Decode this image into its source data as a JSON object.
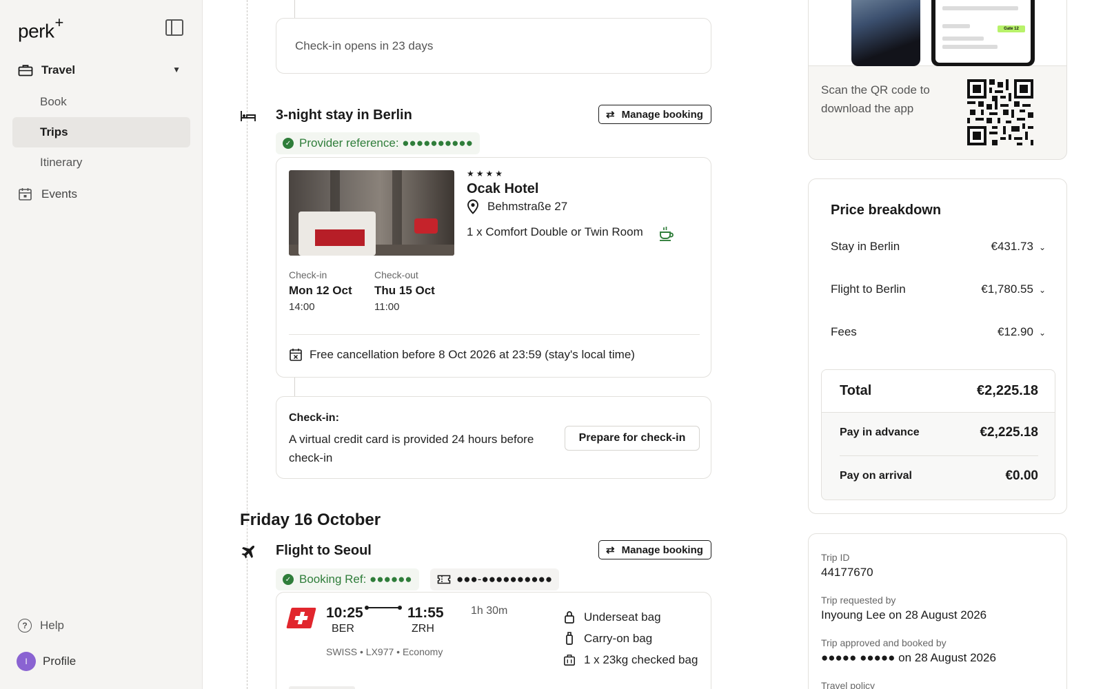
{
  "sidebar": {
    "logo": "perk",
    "logo_mark": "+",
    "travel_label": "Travel",
    "items": [
      {
        "label": "Book"
      },
      {
        "label": "Trips"
      },
      {
        "label": "Itinerary"
      }
    ],
    "events_label": "Events",
    "help_label": "Help",
    "profile_label": "Profile",
    "profile_initial": "I"
  },
  "checkin_notice": "Check-in opens in 23 days",
  "hotel_section": {
    "title": "3-night stay in Berlin",
    "manage_label": "Manage booking",
    "provider_reference": "Provider reference: ●●●●●●●●●●",
    "stars": "★★★★",
    "hotel_name": "Ocak Hotel",
    "address": "Behmstraße 27",
    "room": "1 x Comfort Double or Twin Room",
    "checkin_label": "Check-in",
    "checkin_date": "Mon 12 Oct",
    "checkin_time": "14:00",
    "checkout_label": "Check-out",
    "checkout_date": "Thu 15 Oct",
    "checkout_time": "11:00",
    "cancellation": "Free cancellation before 8 Oct 2026 at 23:59 (stay's local time)"
  },
  "prepare": {
    "title": "Check-in:",
    "text": "A virtual credit card is provided 24 hours before check-in",
    "button": "Prepare for check-in"
  },
  "day_heading": "Friday 16 October",
  "flight_section": {
    "title": "Flight to Seoul",
    "manage_label": "Manage booking",
    "booking_ref": "Booking Ref: ●●●●●●",
    "ticket_ref": "●●●-●●●●●●●●●●",
    "depart_time": "10:25",
    "depart_code": "BER",
    "arrive_time": "11:55",
    "arrive_code": "ZRH",
    "duration": "1h 30m",
    "carrier": "SWISS • LX977 • Economy",
    "bags": [
      {
        "label": "Underseat bag",
        "icon": "lock-bag-icon"
      },
      {
        "label": "Carry-on bag",
        "icon": "carry-on-icon"
      },
      {
        "label": "1 x 23kg checked bag",
        "icon": "suitcase-icon"
      }
    ]
  },
  "app_promo": {
    "text": "Scan the QR code to download the app",
    "screen_pill": "Gate 12"
  },
  "price_breakdown": {
    "title": "Price breakdown",
    "rows": [
      {
        "label": "Stay in Berlin",
        "amount": "€431.73"
      },
      {
        "label": "Flight to Berlin",
        "amount": "€1,780.55"
      },
      {
        "label": "Fees",
        "amount": "€12.90"
      }
    ],
    "total_label": "Total",
    "total_amount": "€2,225.18",
    "advance_label": "Pay in advance",
    "advance_amount": "€2,225.18",
    "arrival_label": "Pay on arrival",
    "arrival_amount": "€0.00"
  },
  "trip_info": {
    "id_label": "Trip ID",
    "id_value": "44177670",
    "requested_label": "Trip requested by",
    "requested_value": "Inyoung Lee on 28 August 2026",
    "approved_label": "Trip approved and booked by",
    "approved_value": "●●●●● ●●●●● on 28 August 2026",
    "policy_label": "Travel policy"
  },
  "colors": {
    "accent_green": "#2f7d3a",
    "swiss_red": "#e1262d",
    "avatar_purple": "#8a63d2"
  }
}
